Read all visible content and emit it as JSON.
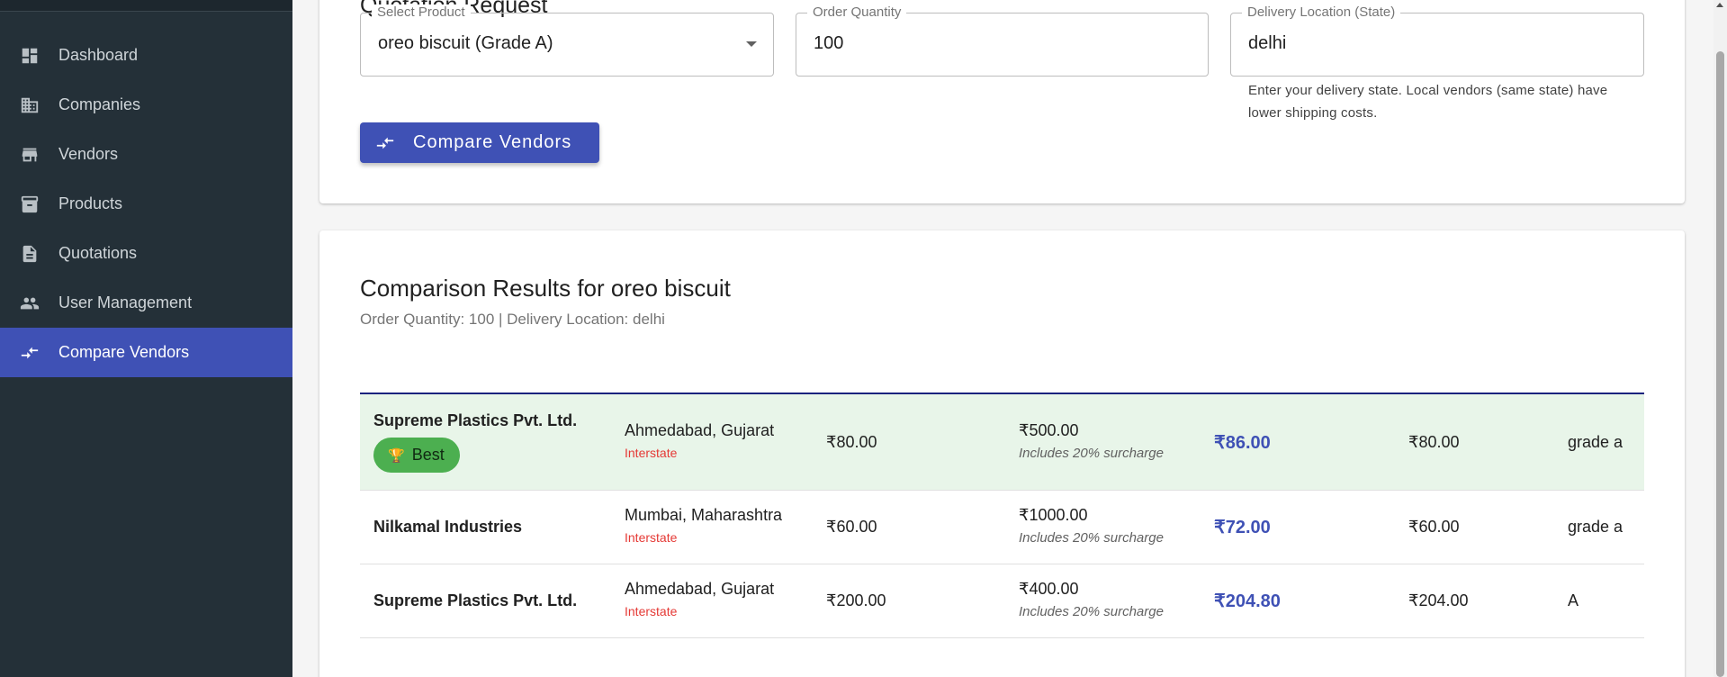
{
  "sidebar": {
    "items": [
      {
        "label": "Dashboard",
        "icon": "dashboard-icon"
      },
      {
        "label": "Companies",
        "icon": "building-icon"
      },
      {
        "label": "Vendors",
        "icon": "store-icon"
      },
      {
        "label": "Products",
        "icon": "archive-box-icon"
      },
      {
        "label": "Quotations",
        "icon": "document-icon"
      },
      {
        "label": "User Management",
        "icon": "people-icon"
      },
      {
        "label": "Compare Vendors",
        "icon": "compare-arrows-icon",
        "active": true
      }
    ]
  },
  "form": {
    "title": "Quotation Request",
    "product": {
      "label": "Select Product",
      "value": "oreo biscuit (Grade A)"
    },
    "quantity": {
      "label": "Order Quantity",
      "value": "100"
    },
    "location": {
      "label": "Delivery Location (State)",
      "value": "delhi"
    },
    "helper": "Enter your delivery state. Local vendors (same state) have lower shipping costs.",
    "compare_button": "Compare Vendors"
  },
  "results": {
    "title": "Comparison Results for oreo biscuit",
    "subtitle": "Order Quantity: 100 | Delivery Location: delhi",
    "rows": [
      {
        "vendor": "Supreme Plastics Pvt. Ltd.",
        "badge": "Best",
        "location": "Ahmedabad, Gujarat",
        "region": "Interstate",
        "price": "₹80.00",
        "shipping": "₹500.00",
        "surcharge": "Includes 20% surcharge",
        "total": "₹86.00",
        "base": "₹80.00",
        "grade": "grade a"
      },
      {
        "vendor": "Nilkamal Industries",
        "location": "Mumbai, Maharashtra",
        "region": "Interstate",
        "price": "₹60.00",
        "shipping": "₹1000.00",
        "surcharge": "Includes 20% surcharge",
        "total": "₹72.00",
        "base": "₹60.00",
        "grade": "grade a"
      },
      {
        "vendor": "Supreme Plastics Pvt. Ltd.",
        "location": "Ahmedabad, Gujarat",
        "region": "Interstate",
        "price": "₹200.00",
        "shipping": "₹400.00",
        "surcharge": "Includes 20% surcharge",
        "total": "₹204.80",
        "base": "₹204.00",
        "grade": "A"
      }
    ]
  },
  "colors": {
    "sidebar_bg": "#243038",
    "accent": "#3f51b5",
    "best_row_bg": "#e8f5e9",
    "badge_green": "#4caf50",
    "interstate_red": "#e53935"
  }
}
